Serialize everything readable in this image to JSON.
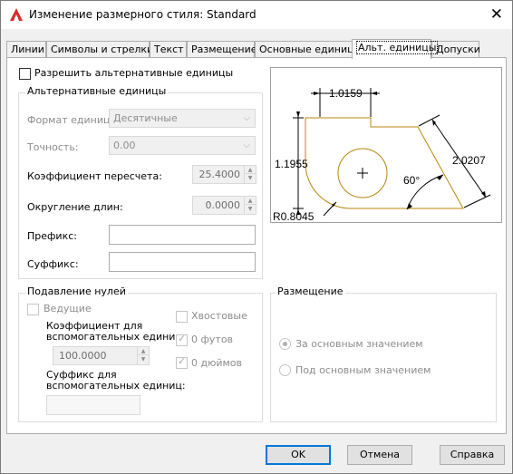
{
  "window": {
    "title": "Изменение размерного стиля: Standard",
    "close_glyph": "✕"
  },
  "tabs": [
    {
      "label": "Линии"
    },
    {
      "label": "Символы и стрелки"
    },
    {
      "label": "Текст"
    },
    {
      "label": "Размещение"
    },
    {
      "label": "Основные единицы"
    },
    {
      "label": "Альт. единицы"
    },
    {
      "label": "Допуски"
    }
  ],
  "alt_units": {
    "enable_label": "Разрешить альтернативные единицы",
    "group_title": "Альтернативные единицы",
    "format_label": "Формат единиц:",
    "format_value": "Десятичные",
    "precision_label": "Точность:",
    "precision_value": "0.00",
    "scale_label": "Коэффициент пересчета:",
    "scale_value": "25.4000",
    "round_label": "Округление длин:",
    "round_value": "0.0000",
    "prefix_label": "Префикс:",
    "prefix_value": "",
    "suffix_label": "Суффикс:",
    "suffix_value": ""
  },
  "zero_suppression": {
    "group_title": "Подавление нулей",
    "leading_label": "Ведущие",
    "subunit_factor_label_1": "Коэффициент для",
    "subunit_factor_label_2": "вспомогательных единиц:",
    "subunit_factor_value": "100.0000",
    "subunit_suffix_label_1": "Суффикс для",
    "subunit_suffix_label_2": "вспомогательных единиц:",
    "subunit_suffix_value": "",
    "trailing_label": "Хвостовые",
    "feet_label": "0 футов",
    "inches_label": "0 дюймов"
  },
  "placement": {
    "group_title": "Размещение",
    "after_label": "За основным значением",
    "below_label": "Под основным значением"
  },
  "preview": {
    "dim_top": "1.0159",
    "dim_left": "1.1955",
    "dim_right": "2.0207",
    "dim_angle": "60°",
    "dim_radius": "R0.8045"
  },
  "buttons": {
    "ok": "OK",
    "cancel": "Отмена",
    "help": "Справка"
  },
  "colors": {
    "accent": "#0078d7",
    "shape": "#b8860b",
    "logo": "#d32f2f"
  }
}
